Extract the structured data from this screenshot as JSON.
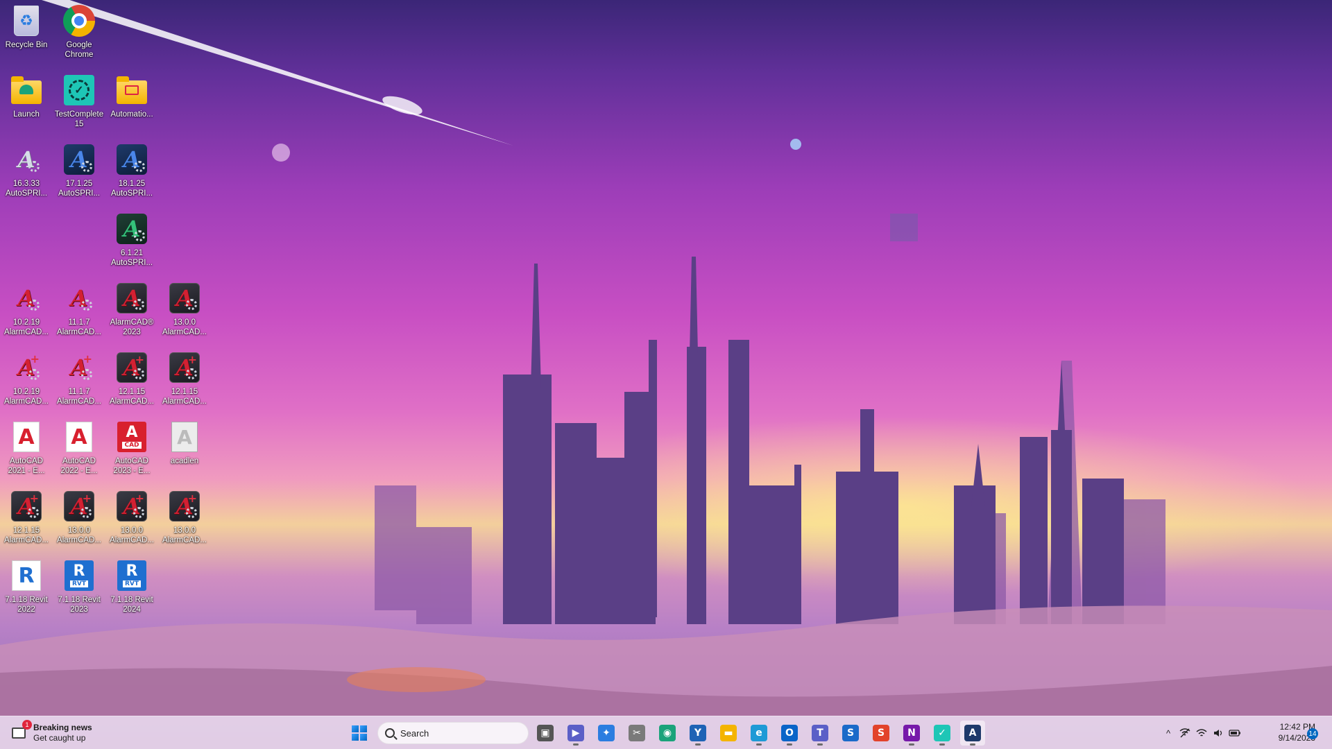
{
  "desktop": {
    "icons": [
      {
        "label": "Recycle Bin",
        "icon": "recycle-bin-icon"
      },
      {
        "label": "Google Chrome",
        "icon": "chrome-icon"
      },
      {
        "label": "Launch",
        "icon": "launch-folder-icon"
      },
      {
        "label": "TestComplete 15",
        "icon": "testcomplete-icon"
      },
      {
        "label": "Automatio...",
        "icon": "automation-folder-icon"
      },
      {
        "label": "16.3.33 AutoSPRI...",
        "icon": "autosprink-icon"
      },
      {
        "label": "17.1.25 AutoSPRI...",
        "icon": "autosprink-icon"
      },
      {
        "label": "18.1.25 AutoSPRI...",
        "icon": "autosprink-icon"
      },
      {
        "label": "6.1.21 AutoSPRI...",
        "icon": "autosprink-icon"
      },
      {
        "label": "10.2.19 AlarmCAD...",
        "icon": "alarmcad-icon"
      },
      {
        "label": "11.1.7 AlarmCAD...",
        "icon": "alarmcad-icon"
      },
      {
        "label": "AlarmCAD® 2023",
        "icon": "alarmcad-icon"
      },
      {
        "label": "13.0.0 AlarmCAD...",
        "icon": "alarmcad-icon"
      },
      {
        "label": "10.2.19 AlarmCAD...",
        "icon": "alarmcad-plus-icon"
      },
      {
        "label": "11.1.7 AlarmCAD...",
        "icon": "alarmcad-plus-icon"
      },
      {
        "label": "12.1.15 AlarmCAD...",
        "icon": "alarmcad-plus-icon"
      },
      {
        "label": "12.1.15 AlarmCAD...",
        "icon": "alarmcad-plus-icon"
      },
      {
        "label": "AutoCAD 2021 - E...",
        "icon": "autocad-icon"
      },
      {
        "label": "AutoCAD 2022 - E...",
        "icon": "autocad-icon"
      },
      {
        "label": "AutoCAD 2023 - E...",
        "icon": "autocad-icon"
      },
      {
        "label": "acadlen",
        "icon": "acad-file-icon"
      },
      {
        "label": "12.1.15 AlarmCAD...",
        "icon": "alarmcad-plus-icon"
      },
      {
        "label": "13.0.0 AlarmCAD...",
        "icon": "alarmcad-plus-icon"
      },
      {
        "label": "13.0.0 AlarmCAD...",
        "icon": "alarmcad-plus-icon"
      },
      {
        "label": "13.0.0 AlarmCAD...",
        "icon": "alarmcad-plus-icon"
      },
      {
        "label": "7.1.18 Revit 2022",
        "icon": "revit-icon"
      },
      {
        "label": "7.1.18 Revit 2023",
        "icon": "revit-icon"
      },
      {
        "label": "7.1.18 Revit 2024",
        "icon": "revit-icon"
      }
    ]
  },
  "taskbar": {
    "news": {
      "title": "Breaking news",
      "subtitle": "Get caught up",
      "badge": "1"
    },
    "search": {
      "placeholder": "Search"
    },
    "apps": [
      {
        "name": "task-view",
        "glyph": "▣",
        "color": "#555555"
      },
      {
        "name": "meet",
        "glyph": "▶",
        "color": "#5b5fc7"
      },
      {
        "name": "copilot",
        "glyph": "✦",
        "color": "#2b7de0"
      },
      {
        "name": "clipboard",
        "glyph": "✂",
        "color": "#7a7a7a"
      },
      {
        "name": "browser-green",
        "glyph": "◉",
        "color": "#1aa37a"
      },
      {
        "name": "y-app",
        "glyph": "Y",
        "color": "#1e63b5"
      },
      {
        "name": "file-explorer",
        "glyph": "▬",
        "color": "#f4b400"
      },
      {
        "name": "edge",
        "glyph": "e",
        "color": "#1e9ad6"
      },
      {
        "name": "outlook",
        "glyph": "O",
        "color": "#0a64c8"
      },
      {
        "name": "teams",
        "glyph": "T",
        "color": "#5b5fc7"
      },
      {
        "name": "s-app-blue",
        "glyph": "S",
        "color": "#1b6ac9"
      },
      {
        "name": "s-app-red",
        "glyph": "S",
        "color": "#e2432b"
      },
      {
        "name": "onenote",
        "glyph": "N",
        "color": "#7719aa"
      },
      {
        "name": "testcomplete",
        "glyph": "✓",
        "color": "#1ec6b6"
      },
      {
        "name": "autosprink",
        "glyph": "A",
        "color": "#1e3a6a"
      }
    ],
    "tray": {
      "chevron": "^",
      "network": "no-network",
      "wifi": "wifi",
      "volume": "volume",
      "battery": "battery"
    },
    "time": "12:42 PM",
    "date": "9/14/2023",
    "notification_count": "14"
  }
}
